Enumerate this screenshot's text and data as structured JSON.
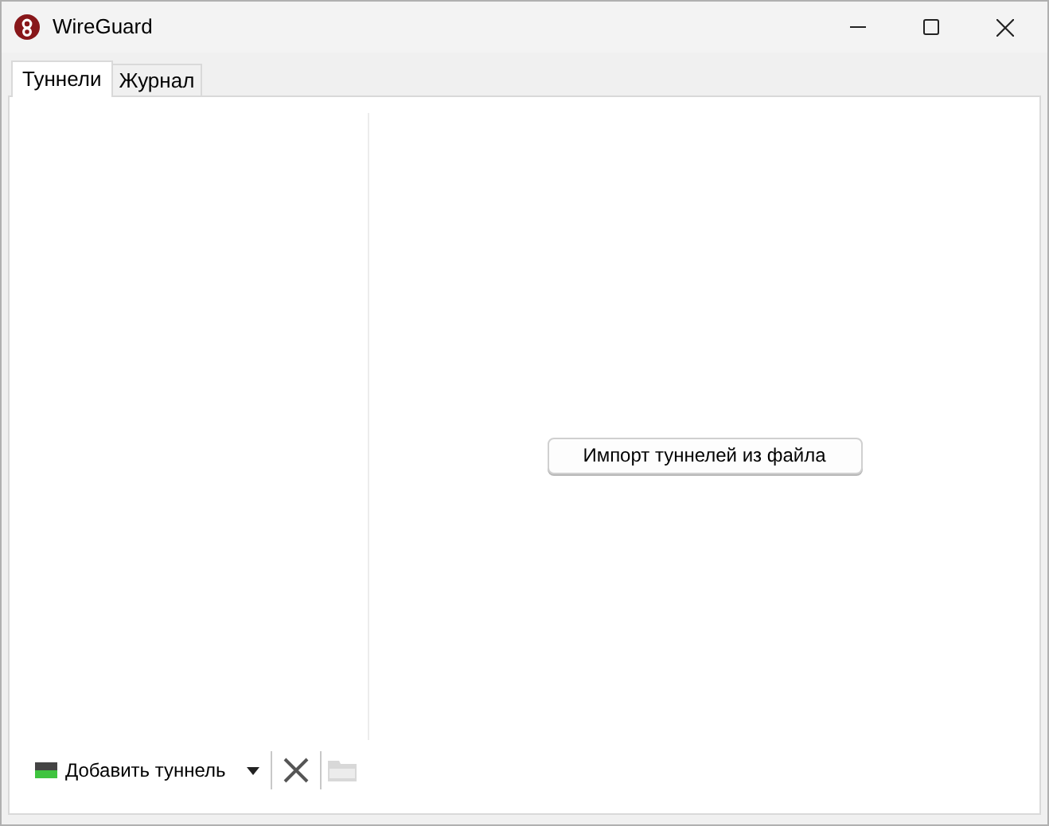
{
  "window": {
    "title": "WireGuard"
  },
  "tabs": [
    {
      "label": "Туннели",
      "selected": true
    },
    {
      "label": "Журнал",
      "selected": false
    }
  ],
  "toolbar": {
    "add_button": "Добавить туннель"
  },
  "import_button": "Импорт туннелей из файла"
}
